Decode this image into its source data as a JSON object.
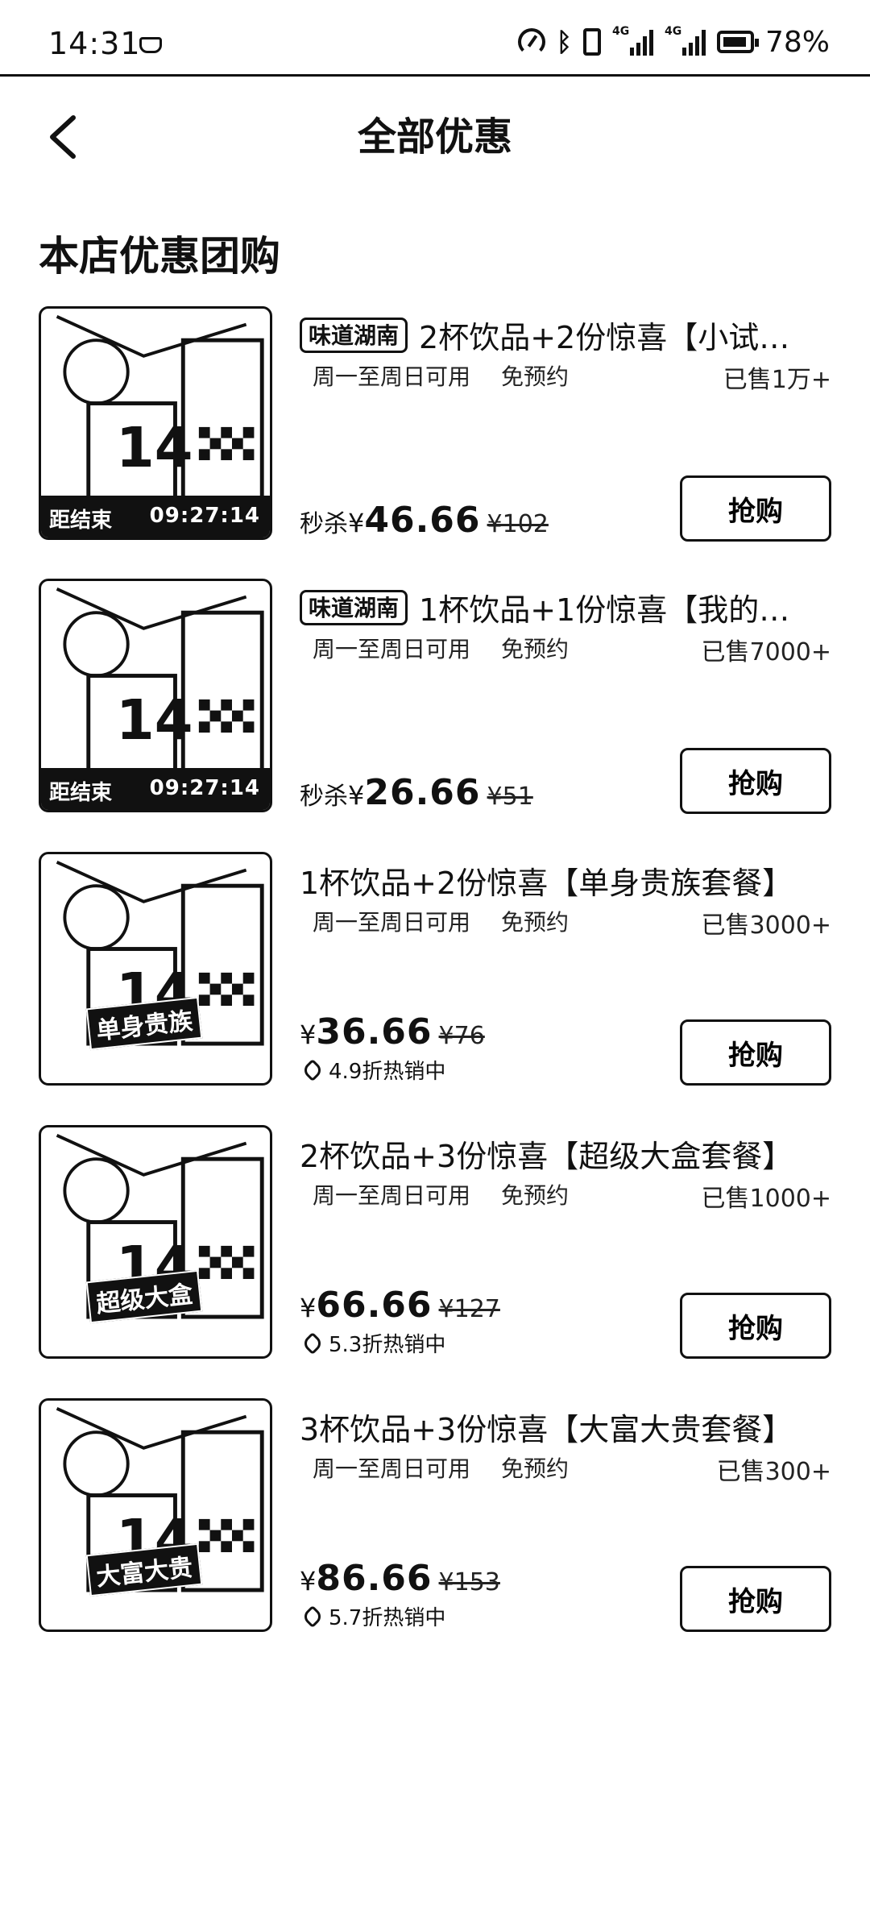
{
  "status_bar": {
    "time": "14:31",
    "battery": "78%",
    "network_labels": [
      "4G",
      "4G"
    ]
  },
  "header": {
    "title": "全部优惠"
  },
  "section": {
    "title": "本店优惠团购"
  },
  "deals": [
    {
      "badge": "味道湖南",
      "title": "2杯饮品+2份惊喜【小试…",
      "availability": "周一至周日可用",
      "reservation": "免预约",
      "sold": "已售1万+",
      "price_prefix": "秒杀",
      "price": "46.66",
      "original_price": "¥102",
      "countdown_label": "距结束",
      "countdown": "09:27:14",
      "buy_label": "抢购"
    },
    {
      "badge": "味道湖南",
      "title": "1杯饮品+1份惊喜【我的…",
      "availability": "周一至周日可用",
      "reservation": "免预约",
      "sold": "已售7000+",
      "price_prefix": "秒杀",
      "price": "26.66",
      "original_price": "¥51",
      "countdown_label": "距结束",
      "countdown": "09:27:14",
      "buy_label": "抢购"
    },
    {
      "title": "1杯饮品+2份惊喜【单身贵族套餐】",
      "availability": "周一至周日可用",
      "reservation": "免预约",
      "sold": "已售3000+",
      "price": "36.66",
      "original_price": "¥76",
      "discount": "4.9折热销中",
      "image_tag": "单身贵族",
      "buy_label": "抢购"
    },
    {
      "title": "2杯饮品+3份惊喜【超级大盒套餐】",
      "availability": "周一至周日可用",
      "reservation": "免预约",
      "sold": "已售1000+",
      "price": "66.66",
      "original_price": "¥127",
      "discount": "5.3折热销中",
      "image_tag": "超级大盒",
      "buy_label": "抢购"
    },
    {
      "title": "3杯饮品+3份惊喜【大富大贵套餐】",
      "availability": "周一至周日可用",
      "reservation": "免预约",
      "sold": "已售300+",
      "price": "86.66",
      "original_price": "¥153",
      "discount": "5.7折热销中",
      "image_tag": "大富大贵",
      "buy_label": "抢购"
    }
  ]
}
